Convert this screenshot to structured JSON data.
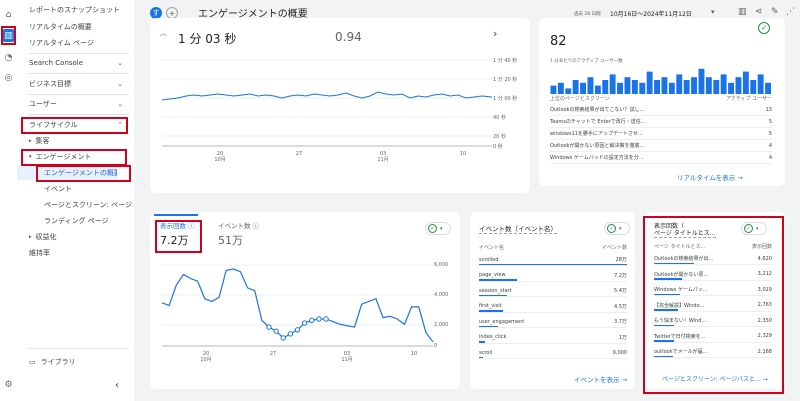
{
  "nav": {
    "items": [
      "レポートのスナップショット",
      "リアルタイムの概要",
      "リアルタイム ページ"
    ],
    "search_console": "Search Console",
    "business_goals": "ビジネス目標",
    "user": "ユーザー",
    "lifecycle": "ライフサイクル",
    "acquisition": "集客",
    "engagement": "エンゲージメント",
    "engagement_overview": "エンゲージメントの概要",
    "events": "イベント",
    "pages_screens": "ページとスクリーン: ページ...",
    "landing": "ランディング ページ",
    "monetization": "収益化",
    "retention": "維持率",
    "library": "ライブラリ"
  },
  "header": {
    "avatar": "す",
    "add": "+",
    "title": "エンゲージメントの概要",
    "range_label": "過去 28 日間",
    "range": "10月16日～2024年11月12日"
  },
  "top_card": {
    "metric1": "1 分 03 秒",
    "metric2": "0.94",
    "yticks": [
      "1 分 40 秒",
      "1 分 20 秒",
      "1 分 00 秒",
      "40 秒",
      "20 秒",
      "0 秒"
    ],
    "xticks": [
      {
        "d": "20",
        "m": "10月"
      },
      {
        "d": "27",
        "m": ""
      },
      {
        "d": "03",
        "m": "11月"
      },
      {
        "d": "10",
        "m": ""
      }
    ]
  },
  "realtime": {
    "value": "82",
    "sublabel": "1 分あたりのアクティブ ユーザー数",
    "col1": "上位のページとスクリーン",
    "col2": "アクティブ ユーザー",
    "rows": [
      {
        "l": "Outlookの検索結果が出てこない？試し...",
        "v": "13"
      },
      {
        "l": "Teamsのチャットで Enterで改行・送信...",
        "v": "5"
      },
      {
        "l": "windows11を勝手にアップデートさせ...",
        "v": "5"
      },
      {
        "l": "Outlookが開かない原因と解決策を徹底...",
        "v": "4"
      },
      {
        "l": "Windows ゲームバッドの設定方法を分...",
        "v": "4"
      }
    ],
    "link": "リアルタイムを表示 →"
  },
  "views_card": {
    "tab1_label": "表示回数",
    "tab1_value": "7.2万",
    "tab2_label": "イベント数",
    "tab2_value": "51万",
    "yticks": [
      "6,000",
      "4,000",
      "2,000",
      "0"
    ],
    "xticks": [
      {
        "d": "20",
        "m": "10月"
      },
      {
        "d": "27",
        "m": ""
      },
      {
        "d": "03",
        "m": "11月"
      },
      {
        "d": "10",
        "m": ""
      }
    ]
  },
  "events_card": {
    "title": "イベント数（イベント名）",
    "col1": "イベント名",
    "col2": "イベント数",
    "rows": [
      {
        "l": "scrolled",
        "v": "28万",
        "p": 1.0
      },
      {
        "l": "page_view",
        "v": "7.2万",
        "p": 0.26
      },
      {
        "l": "session_start",
        "v": "5.4万",
        "p": 0.19
      },
      {
        "l": "first_visit",
        "v": "4.5万",
        "p": 0.16
      },
      {
        "l": "user_engagement",
        "v": "3.7万",
        "p": 0.13
      },
      {
        "l": "index_click",
        "v": "1万",
        "p": 0.04
      },
      {
        "l": "scroll",
        "v": "9,000",
        "p": 0.03
      }
    ],
    "link": "イベントを表示 →"
  },
  "pages_card": {
    "title1": "表示回数（",
    "title2": "ページ タイトルとス...",
    "col1": "ページ タイトルとス...",
    "col2": "表示回数",
    "rows": [
      {
        "l": "Outlookの検索結果が出...",
        "v": "4,620",
        "p": 1.0
      },
      {
        "l": "Outlookが開かない原...",
        "v": "3,212",
        "p": 0.7
      },
      {
        "l": "Windows ゲームパッ...",
        "v": "3,019",
        "p": 0.65
      },
      {
        "l": "【完全解説】Windo...",
        "v": "2,763",
        "p": 0.6
      },
      {
        "l": "もう悩まない！Wind...",
        "v": "2,350",
        "p": 0.51
      },
      {
        "l": "Twitterで日付検索を...",
        "v": "2,329",
        "p": 0.5
      },
      {
        "l": "outlookでメールが届...",
        "v": "2,168",
        "p": 0.47
      }
    ],
    "link": "ページとスクリーン: ページパスと... →"
  }
}
